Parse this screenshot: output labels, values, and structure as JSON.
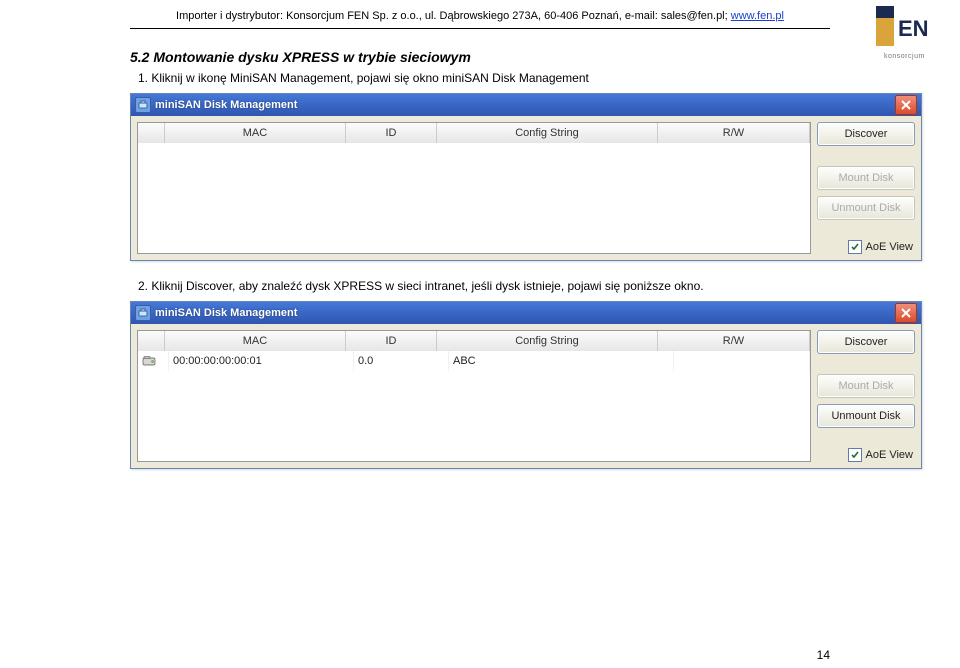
{
  "header": {
    "prefix": "Importer i dystrybutor: Konsorcjum FEN Sp. z o.o., ul. Dąbrowskiego 273A, 60-406 Poznań, e-mail: sales@fen.pl; ",
    "link": "www.fen.pl"
  },
  "logo": {
    "top_text": "FEN",
    "bottom_text": "konsorcjum"
  },
  "section_title": "5.2 Montowanie dysku XPRESS w trybie sieciowym",
  "step1": "1.  Kliknij w ikonę MiniSAN Management, pojawi się okno miniSAN Disk Management",
  "step2": "2.  Kliknij Discover, aby znaleźć dysk XPRESS w sieci intranet, jeśli dysk istnieje, pojawi się poniższe okno.",
  "wincommon": {
    "title": "miniSAN Disk Management",
    "cols": {
      "mac": "MAC",
      "id": "ID",
      "cs": "Config String",
      "rw": "R/W"
    },
    "btn_discover": "Discover",
    "btn_mount": "Mount Disk",
    "btn_unmount": "Unmount Disk",
    "chk_label": "AoE View"
  },
  "win2": {
    "row": {
      "mac": "00:00:00:00:00:01",
      "id": "0.0",
      "cs": "ABC",
      "rw": ""
    },
    "mount_disabled": true
  },
  "page_number": "14"
}
